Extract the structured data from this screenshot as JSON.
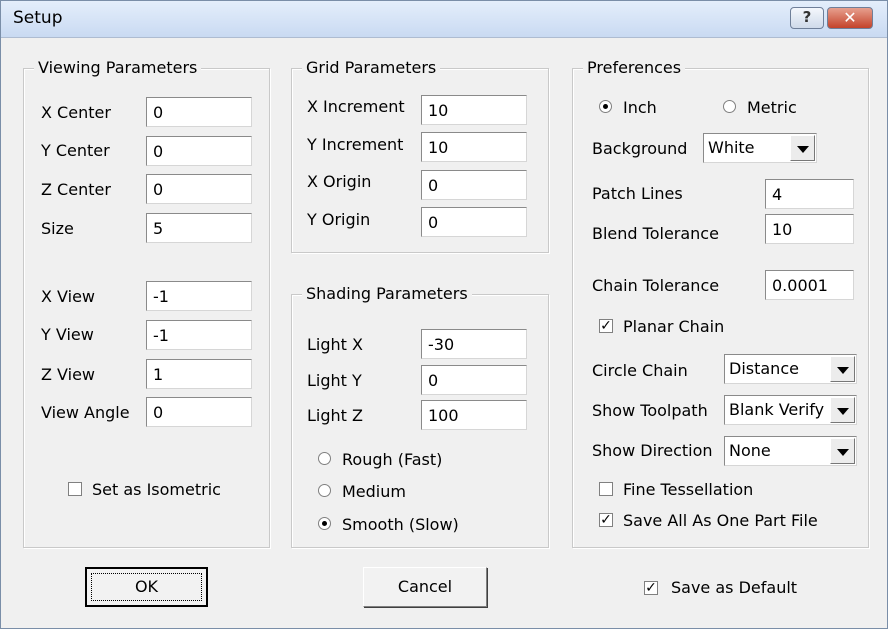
{
  "window": {
    "title": "Setup",
    "help_glyph": "?",
    "close_glyph": "✕"
  },
  "viewing": {
    "legend": "Viewing Parameters",
    "x_center": {
      "label": "X Center",
      "value": "0"
    },
    "y_center": {
      "label": "Y Center",
      "value": "0"
    },
    "z_center": {
      "label": "Z Center",
      "value": "0"
    },
    "size": {
      "label": "Size",
      "value": "5"
    },
    "x_view": {
      "label": "X View",
      "value": "-1"
    },
    "y_view": {
      "label": "Y View",
      "value": "-1"
    },
    "z_view": {
      "label": "Z View",
      "value": "1"
    },
    "view_angle": {
      "label": "View Angle",
      "value": "0"
    },
    "isometric": {
      "label": "Set as Isometric",
      "checked": false
    }
  },
  "grid": {
    "legend": "Grid Parameters",
    "x_increment": {
      "label": "X Increment",
      "value": "10"
    },
    "y_increment": {
      "label": "Y Increment",
      "value": "10"
    },
    "x_origin": {
      "label": "X Origin",
      "value": "0"
    },
    "y_origin": {
      "label": "Y Origin",
      "value": "0"
    }
  },
  "shading": {
    "legend": "Shading Parameters",
    "light_x": {
      "label": "Light X",
      "value": "-30"
    },
    "light_y": {
      "label": "Light Y",
      "value": "0"
    },
    "light_z": {
      "label": "Light Z",
      "value": "100"
    },
    "quality": {
      "options": [
        "Rough (Fast)",
        "Medium",
        "Smooth (Slow)"
      ],
      "selected": "Smooth (Slow)"
    }
  },
  "preferences": {
    "legend": "Preferences",
    "units": {
      "options": [
        "Inch",
        "Metric"
      ],
      "selected": "Inch"
    },
    "background": {
      "label": "Background",
      "value": "White"
    },
    "patch_lines": {
      "label": "Patch Lines",
      "value": "4"
    },
    "blend_tolerance": {
      "label": "Blend Tolerance",
      "value": "10"
    },
    "chain_tolerance": {
      "label": "Chain Tolerance",
      "value": "0.0001"
    },
    "planar_chain": {
      "label": "Planar Chain",
      "checked": true
    },
    "circle_chain": {
      "label": "Circle Chain",
      "value": "Distance"
    },
    "show_toolpath": {
      "label": "Show Toolpath",
      "value": "Blank Verify"
    },
    "show_direction": {
      "label": "Show Direction",
      "value": "None"
    },
    "fine_tessellation": {
      "label": "Fine Tessellation",
      "checked": false
    },
    "save_one_part": {
      "label": "Save All As One Part File",
      "checked": true
    }
  },
  "footer": {
    "ok_label": "OK",
    "cancel_label": "Cancel",
    "save_default": {
      "label": "Save as Default",
      "checked": true
    }
  },
  "glyphs": {
    "check": "✓"
  }
}
